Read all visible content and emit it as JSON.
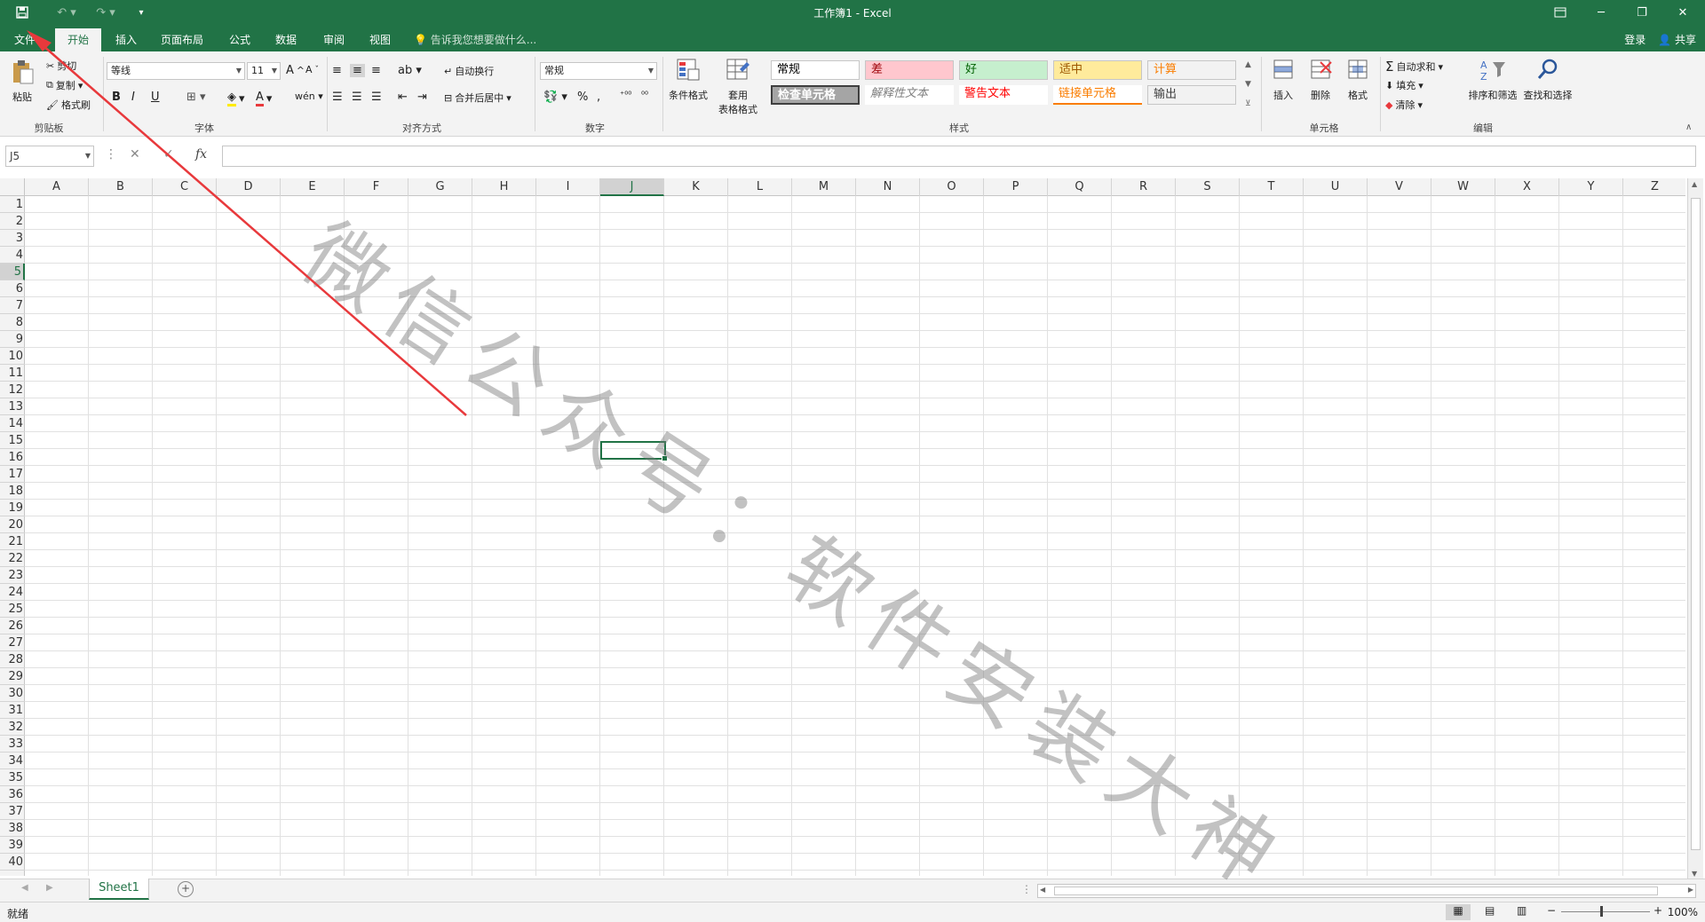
{
  "window": {
    "title": "工作簿1 - Excel"
  },
  "tabs": [
    {
      "label": "文件"
    },
    {
      "label": "开始"
    },
    {
      "label": "插入"
    },
    {
      "label": "页面布局"
    },
    {
      "label": "公式"
    },
    {
      "label": "数据"
    },
    {
      "label": "审阅"
    },
    {
      "label": "视图"
    }
  ],
  "tellme": "告诉我您想要做什么...",
  "account": {
    "login": "登录",
    "share": "共享"
  },
  "ribbon": {
    "clipboard": {
      "paste": "粘贴",
      "cut": "剪切",
      "copy": "复制",
      "format_painter": "格式刷",
      "label": "剪贴板"
    },
    "font": {
      "name": "等线",
      "size": "11",
      "label": "字体",
      "bold": "B",
      "italic": "I",
      "underline": "U"
    },
    "align": {
      "wrap": "自动换行",
      "merge": "合并后居中",
      "label": "对齐方式"
    },
    "number": {
      "format": "常规",
      "label": "数字",
      "percent": "%"
    },
    "styles": {
      "cond_format": "条件格式",
      "table_format_1": "套用",
      "table_format_2": "表格格式",
      "label": "样式",
      "cells": [
        {
          "text": "常规",
          "bg": "#ffffff",
          "fg": "#000000"
        },
        {
          "text": "差",
          "bg": "#ffc7ce",
          "fg": "#9c0006"
        },
        {
          "text": "好",
          "bg": "#c6efce",
          "fg": "#006100"
        },
        {
          "text": "适中",
          "bg": "#ffeb9c",
          "fg": "#9c5700"
        },
        {
          "text": "计算",
          "bg": "#f2f2f2",
          "fg": "#fa7d00"
        },
        {
          "text": "检查单元格",
          "bg": "#a5a5a5",
          "fg": "#ffffff"
        },
        {
          "text": "解释性文本",
          "bg": "#ffffff",
          "fg": "#7f7f7f"
        },
        {
          "text": "警告文本",
          "bg": "#ffffff",
          "fg": "#ff0000"
        },
        {
          "text": "链接单元格",
          "bg": "#ffffff",
          "fg": "#fa7d00"
        },
        {
          "text": "输出",
          "bg": "#f2f2f2",
          "fg": "#3f3f3f"
        }
      ]
    },
    "cells_group": {
      "insert": "插入",
      "delete": "删除",
      "format": "格式",
      "label": "单元格"
    },
    "editing": {
      "autosum": "自动求和",
      "fill": "填充",
      "clear": "清除",
      "sort": "排序和筛选",
      "find": "查找和选择",
      "label": "编辑"
    }
  },
  "formula_bar": {
    "name_box": "J5",
    "fx": "fx"
  },
  "columns": [
    "A",
    "B",
    "C",
    "D",
    "E",
    "F",
    "G",
    "H",
    "I",
    "J",
    "K",
    "L",
    "M",
    "N",
    "O",
    "P",
    "Q",
    "R",
    "S",
    "T",
    "U",
    "V",
    "W",
    "X",
    "Y",
    "Z"
  ],
  "selected_column": "J",
  "selected_row": 5,
  "row_count": 40,
  "sheet": {
    "name": "Sheet1"
  },
  "status": {
    "ready": "就绪",
    "zoom": "100%"
  },
  "watermark": "微信公众号：软件安装大神",
  "colors": {
    "excel_green": "#217346",
    "arrow": "#e8393c"
  }
}
